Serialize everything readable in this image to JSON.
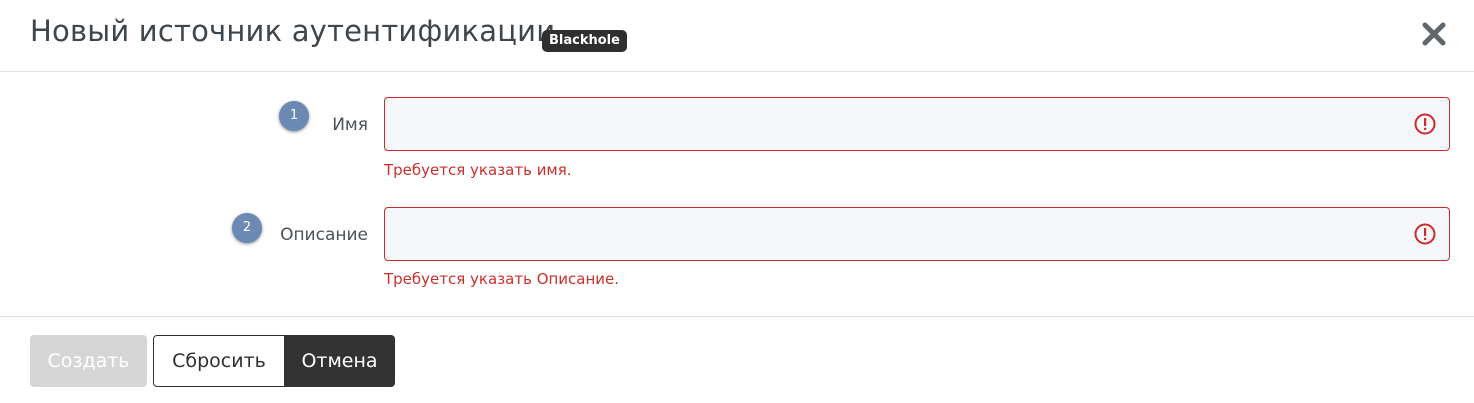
{
  "dialog": {
    "title": "Новый источник аутентификации",
    "badge": "Blackhole"
  },
  "fields": [
    {
      "step": "1",
      "label": "Имя",
      "value": "",
      "error": "Требуется указать имя."
    },
    {
      "step": "2",
      "label": "Описание",
      "value": "",
      "error": "Требуется указать Описание."
    }
  ],
  "footer": {
    "create_label": "Создать",
    "reset_label": "Сбросить",
    "cancel_label": "Отмена"
  },
  "colors": {
    "error": "#cf2a2a",
    "step_badge": "#6c89b3",
    "dark_button": "#333333",
    "disabled_button": "#d6d6d6"
  },
  "icons": [
    "close-icon",
    "error-icon"
  ]
}
